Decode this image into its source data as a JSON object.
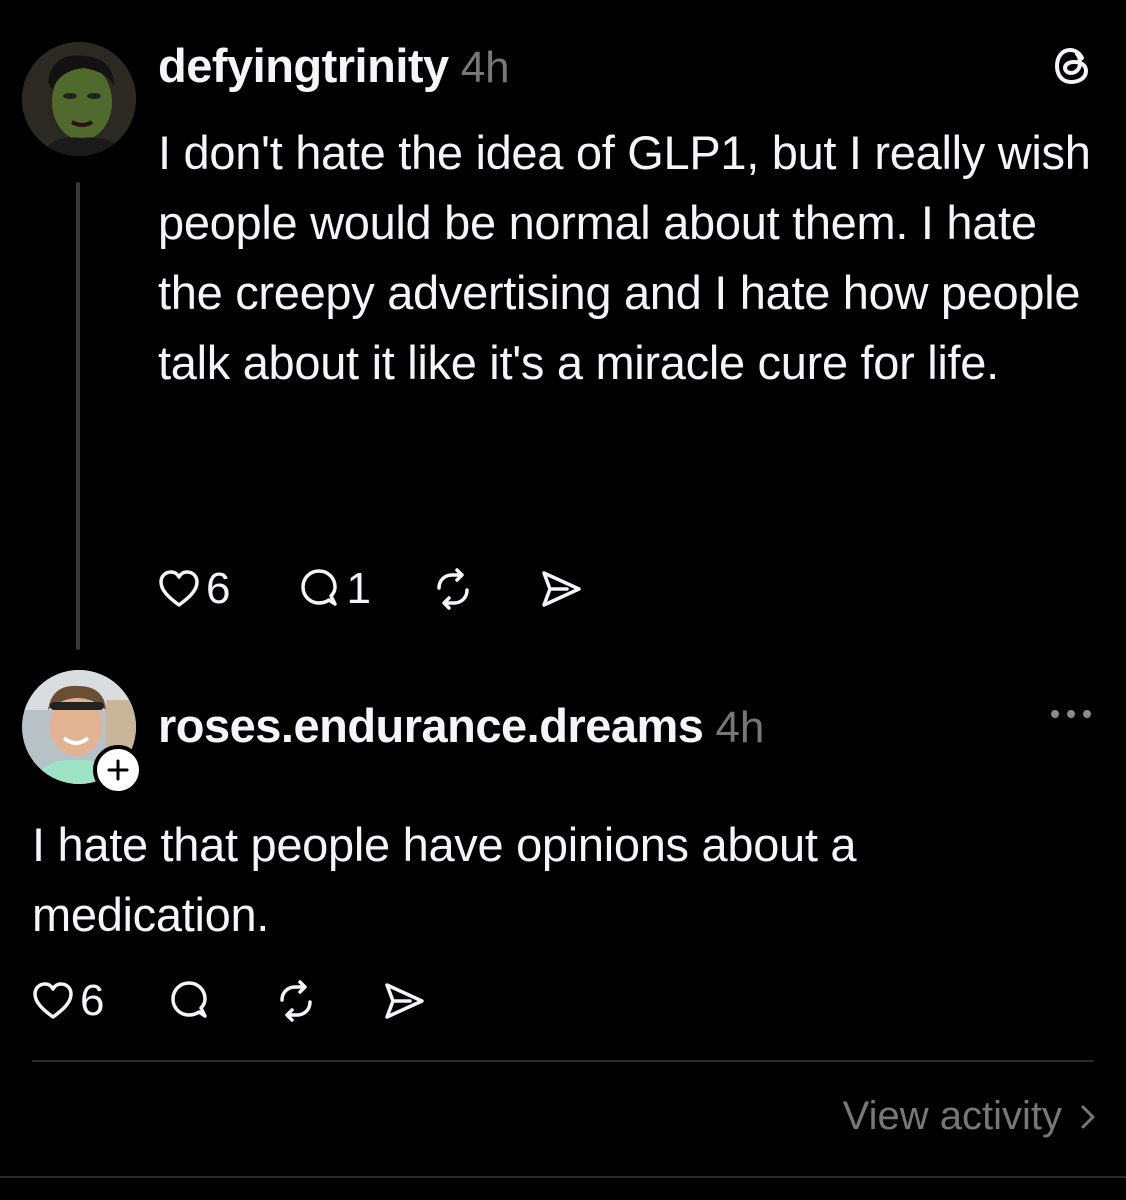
{
  "post": {
    "username": "defyingtrinity",
    "time": "4h",
    "text": "I don't hate the idea of GLP1, but I really wish people would be normal about them. I hate the creepy advertising and I hate how people talk about it like it's a miracle cure for life.",
    "likes": "6",
    "replies": "1",
    "logo_icon": "threads-logo-icon"
  },
  "reply": {
    "username": "roses.endurance.dreams",
    "time": "4h",
    "text": "I hate that people have opinions about a medication.",
    "likes": "6",
    "follow_icon": "plus-icon",
    "more_icon": "more-options-icon"
  },
  "footer": {
    "view_activity": "View activity"
  },
  "colors": {
    "background": "#000000",
    "text": "#f3f5f7",
    "muted": "#777777",
    "thread_line": "#3a3a3c"
  }
}
